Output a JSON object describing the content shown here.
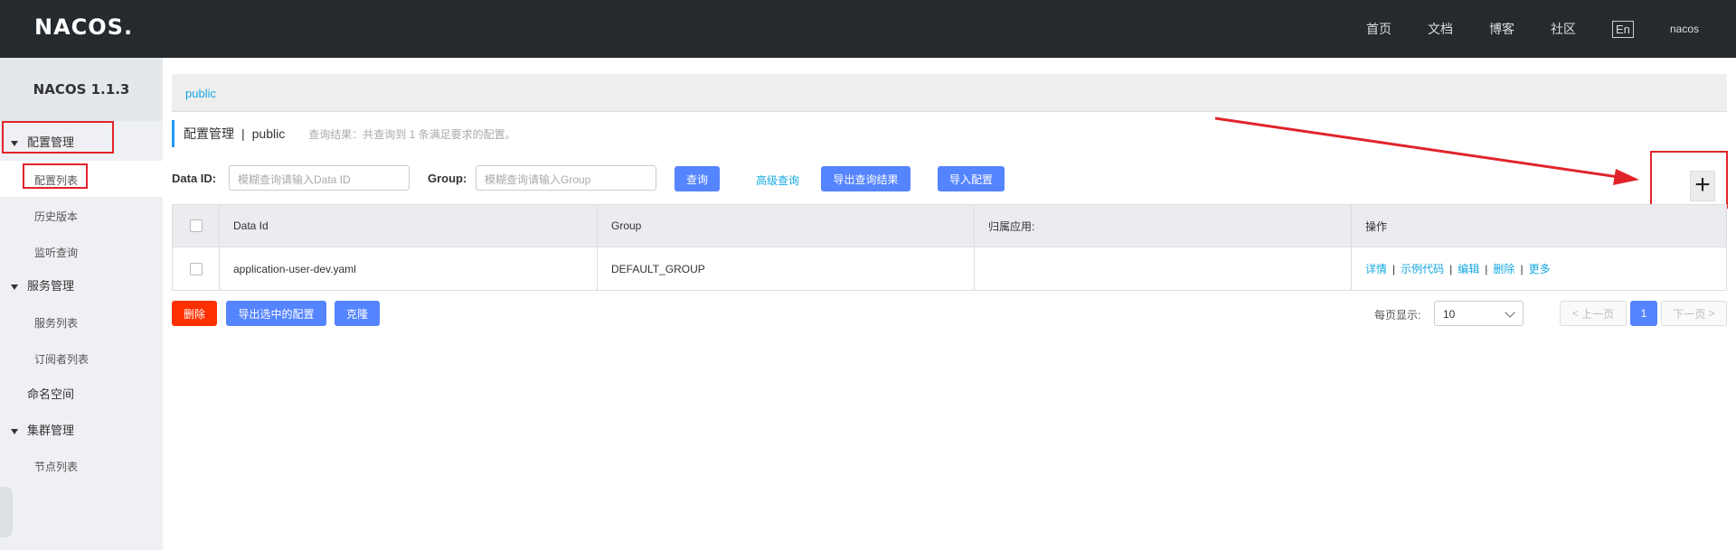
{
  "header": {
    "logo": "NACOS.",
    "nav": [
      "首页",
      "文档",
      "博客",
      "社区"
    ],
    "lang": "En",
    "user": "nacos"
  },
  "sidebar": {
    "title": "NACOS 1.1.3",
    "groups": [
      {
        "label": "配置管理",
        "items": [
          "配置列表",
          "历史版本",
          "监听查询"
        ]
      },
      {
        "label": "服务管理",
        "items": [
          "服务列表",
          "订阅者列表"
        ]
      },
      {
        "label": "命名空间"
      },
      {
        "label": "集群管理",
        "items": [
          "节点列表"
        ]
      }
    ]
  },
  "breadcrumb": "public",
  "page": {
    "title": "配置管理",
    "namespace": "public",
    "hint": "查询结果：共查询到 1 条满足要求的配置。"
  },
  "search": {
    "dataid_label": "Data ID:",
    "dataid_placeholder": "模糊查询请输入Data ID",
    "group_label": "Group:",
    "group_placeholder": "模糊查询请输入Group",
    "query_btn": "查询",
    "advanced": "高级查询",
    "export_btn": "导出查询结果",
    "import_btn": "导入配置"
  },
  "add_btn": "+",
  "table": {
    "headers": [
      "Data Id",
      "Group",
      "归属应用:",
      "操作"
    ],
    "rows": [
      {
        "data_id": "application-user-dev.yaml",
        "group": "DEFAULT_GROUP",
        "app": "",
        "ops": [
          "详情",
          "示例代码",
          "编辑",
          "删除",
          "更多"
        ]
      }
    ]
  },
  "footer": {
    "delete_btn": "删除",
    "export_selected_btn": "导出选中的配置",
    "clone_btn": "克隆",
    "page_size_label": "每页显示:",
    "page_size": "10",
    "prev": "上一页",
    "current_page": "1",
    "next": "下一页"
  },
  "colors": {
    "topbar": "#252a2f",
    "primary": "#5584ff",
    "danger": "#ff3000",
    "link": "#16a9e0",
    "annotation": "#e0242a"
  }
}
